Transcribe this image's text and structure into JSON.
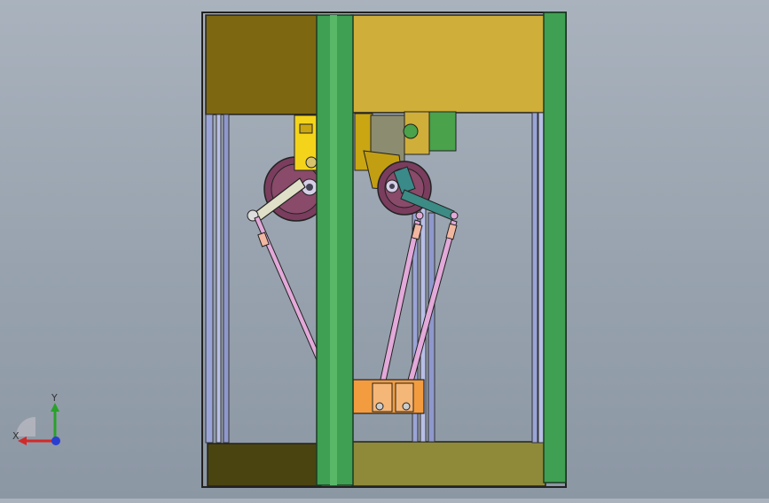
{
  "viewport": {
    "background_top": "#a9b2bd",
    "background_bottom": "#8c97a4"
  },
  "model": {
    "frame_color": "#3f9f52",
    "panel_color": "#cfae3a",
    "panel_dark_color": "#7d6711",
    "rod_color": "#e2a9d9",
    "effector_color": "#f39c3f"
  },
  "triad": {
    "x_label": "X",
    "y_label": "Y",
    "x_color": "#d12a2a",
    "y_color": "#2aa12a",
    "z_color": "#2a3fd1"
  }
}
